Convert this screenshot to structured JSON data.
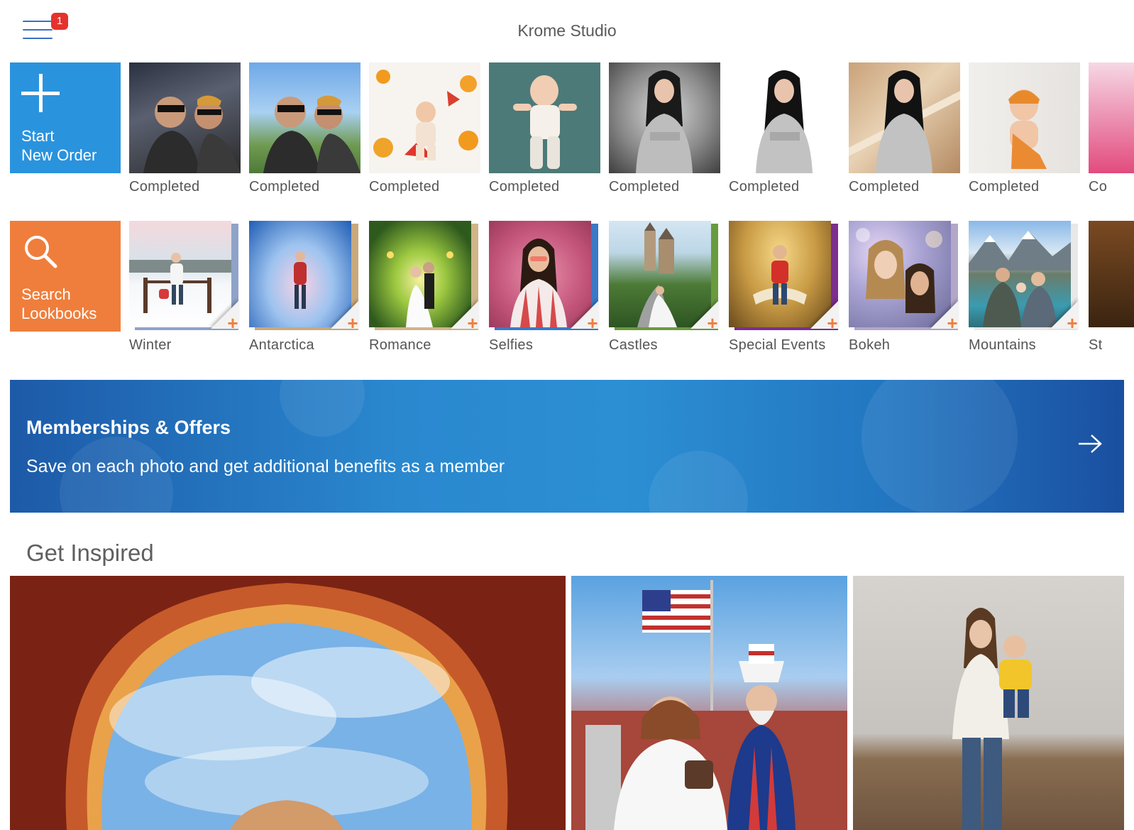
{
  "header": {
    "title": "Krome Studio",
    "menu_badge": "1"
  },
  "orders": {
    "start_tile": {
      "line1": "Start",
      "line2": "New Order"
    },
    "items": [
      {
        "status": "Completed",
        "thumb": "two-men-sunglasses-city"
      },
      {
        "status": "Completed",
        "thumb": "two-men-sunglasses-park"
      },
      {
        "status": "Completed",
        "thumb": "baby-autumn-leaves"
      },
      {
        "status": "Completed",
        "thumb": "baby-teal-backdrop"
      },
      {
        "status": "Completed",
        "thumb": "woman-gray-backdrop"
      },
      {
        "status": "Completed",
        "thumb": "woman-white-backdrop"
      },
      {
        "status": "Completed",
        "thumb": "woman-staircase"
      },
      {
        "status": "Completed",
        "thumb": "baby-orange-hat"
      },
      {
        "status": "Co",
        "thumb": "partial"
      }
    ]
  },
  "lookbooks": {
    "search_tile": {
      "line1": "Search",
      "line2": "Lookbooks"
    },
    "items": [
      {
        "name": "Winter",
        "add": "+"
      },
      {
        "name": "Antarctica",
        "add": "+"
      },
      {
        "name": "Romance",
        "add": "+"
      },
      {
        "name": "Selfies",
        "add": "+"
      },
      {
        "name": "Castles",
        "add": "+"
      },
      {
        "name": "Special Events",
        "add": "+"
      },
      {
        "name": "Bokeh",
        "add": "+"
      },
      {
        "name": "Mountains",
        "add": "+"
      },
      {
        "name": "St",
        "add": ""
      }
    ]
  },
  "banner": {
    "title": "Memberships & Offers",
    "subtitle": "Save on each photo and get additional benefits as a member"
  },
  "inspire": {
    "title": "Get Inspired"
  },
  "colors": {
    "accent_blue": "#2a93dd",
    "accent_orange": "#ef7e3c",
    "badge_red": "#e5322d",
    "menu_blue": "#3a6fc4"
  },
  "icons": {
    "menu": "hamburger-menu-icon",
    "add": "plus-icon",
    "search": "magnifier-icon",
    "arrow": "arrow-right-icon"
  }
}
